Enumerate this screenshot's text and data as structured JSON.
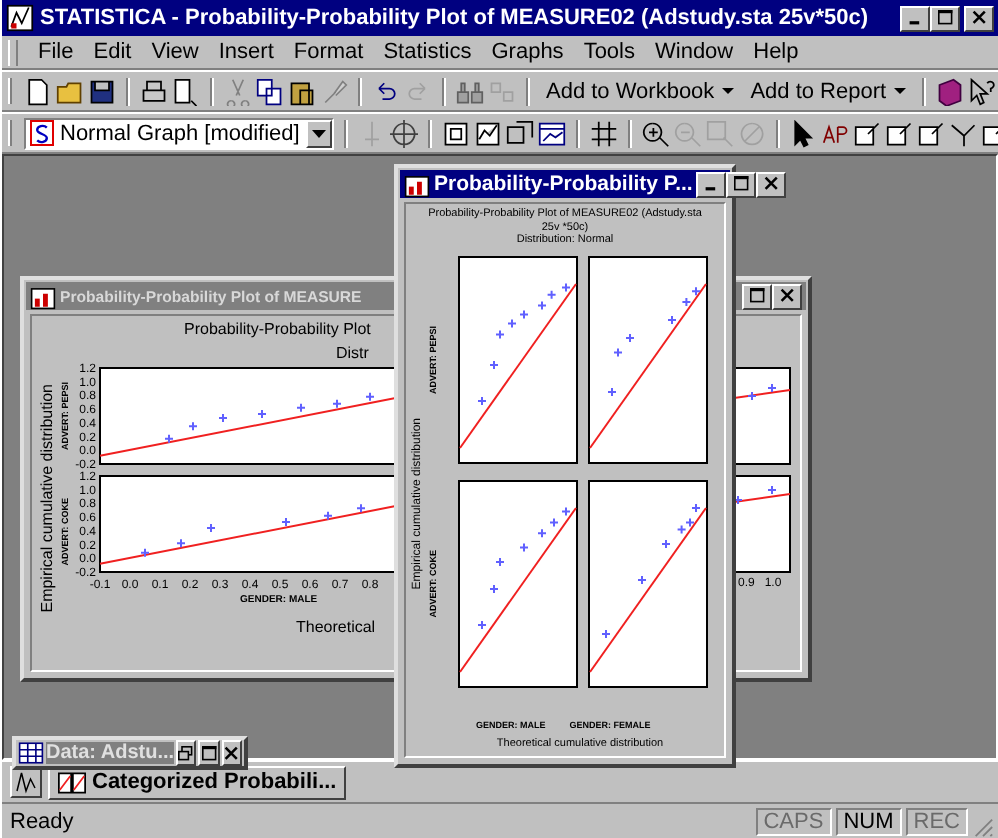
{
  "window": {
    "title": "STATISTICA - Probability-Probability Plot of MEASURE02 (Adstudy.sta 25v*50c)"
  },
  "menu": [
    {
      "label": "File"
    },
    {
      "label": "Edit"
    },
    {
      "label": "View"
    },
    {
      "label": "Insert"
    },
    {
      "label": "Format"
    },
    {
      "label": "Statistics"
    },
    {
      "label": "Graphs"
    },
    {
      "label": "Tools"
    },
    {
      "label": "Window"
    },
    {
      "label": "Help"
    }
  ],
  "toolbar": {
    "buttons": [
      {
        "label": "Add to Workbook"
      },
      {
        "label": "Add to Report"
      }
    ]
  },
  "graph_style": {
    "value": "Normal Graph [modified]"
  },
  "back_window": {
    "title": "Probability-Probability Plot of MEASURE",
    "chart_title": "Probability-Probability Plot",
    "subtitle": "Distr",
    "y_title": "Empirical cumulative distribution",
    "x_title": "Theoretical",
    "column_label": "GENDER: MALE",
    "right_xticks": [
      "0.9",
      "1.0"
    ],
    "panels": [
      {
        "chart_data": {
          "type": "scatter",
          "x": [
            0.13,
            0.21,
            0.31,
            0.44,
            0.57,
            0.69,
            0.8
          ],
          "series": [
            {
              "name": "ADVERT: PEPSI",
              "color": "#6060ff",
              "values": [
                0.17,
                0.35,
                0.47,
                0.53,
                0.62,
                0.68,
                0.78
              ]
            }
          ],
          "xlim": [
            -0.1,
            1.0
          ],
          "ylim": [
            -0.2,
            1.2
          ],
          "yticks": [
            {
              "value": 1.2,
              "label": "1.2"
            },
            {
              "value": 1.0,
              "label": "1.0"
            },
            {
              "value": 0.8,
              "label": "0.8"
            },
            {
              "value": 0.6,
              "label": "0.6"
            },
            {
              "value": 0.4,
              "label": "0.4"
            },
            {
              "value": 0.2,
              "label": "0.2"
            },
            {
              "value": 0,
              "label": "0.0"
            },
            {
              "value": -0.2,
              "label": "-0.2"
            }
          ]
        }
      },
      {
        "chart_data": {
          "type": "scatter",
          "x": [
            0.05,
            0.17,
            0.27,
            0.52,
            0.66,
            0.77
          ],
          "series": [
            {
              "name": "ADVERT: COKE",
              "color": "#6060ff",
              "values": [
                0.08,
                0.22,
                0.44,
                0.53,
                0.62,
                0.73
              ]
            }
          ],
          "xlim": [
            -0.1,
            1.0
          ],
          "ylim": [
            -0.2,
            1.2
          ],
          "yticks": [
            {
              "value": 1.2,
              "label": "1.2"
            },
            {
              "value": 1.0,
              "label": "1.0"
            },
            {
              "value": 0.8,
              "label": "0.8"
            },
            {
              "value": 0.6,
              "label": "0.6"
            },
            {
              "value": 0.4,
              "label": "0.4"
            },
            {
              "value": 0.2,
              "label": "0.2"
            },
            {
              "value": 0,
              "label": "0.0"
            },
            {
              "value": -0.2,
              "label": "-0.2"
            }
          ],
          "xticks": [
            {
              "value": -0.1,
              "label": "-0.1"
            },
            {
              "value": 0,
              "label": "0.0"
            },
            {
              "value": 0.1,
              "label": "0.1"
            },
            {
              "value": 0.2,
              "label": "0.2"
            },
            {
              "value": 0.3,
              "label": "0.3"
            },
            {
              "value": 0.4,
              "label": "0.4"
            },
            {
              "value": 0.5,
              "label": "0.5"
            },
            {
              "value": 0.6,
              "label": "0.6"
            },
            {
              "value": 0.7,
              "label": "0.7"
            },
            {
              "value": 0.8,
              "label": "0.8"
            }
          ]
        }
      }
    ]
  },
  "front_window": {
    "title": "Probability-Probability P...",
    "chart_title": "Probability-Probability Plot of MEASURE02 (Adstudy.sta 25v *50c)",
    "subtitle": "Distribution: Normal",
    "y_title": "Empirical cumulative distribution",
    "x_title": "Theoretical cumulative distribution",
    "rows": [
      "ADVERT: PEPSI",
      "ADVERT: COKE"
    ],
    "columns": [
      "GENDER: MALE",
      "GENDER: FEMALE"
    ]
  },
  "minimized_window": {
    "title": "Data: Adstu..."
  },
  "taskbar": {
    "label": "Categorized Probabili..."
  },
  "status_bar": {
    "text": "Ready",
    "indicators": [
      {
        "label": "CAPS",
        "on": false
      },
      {
        "label": "NUM",
        "on": true
      },
      {
        "label": "REC",
        "on": false
      }
    ]
  }
}
